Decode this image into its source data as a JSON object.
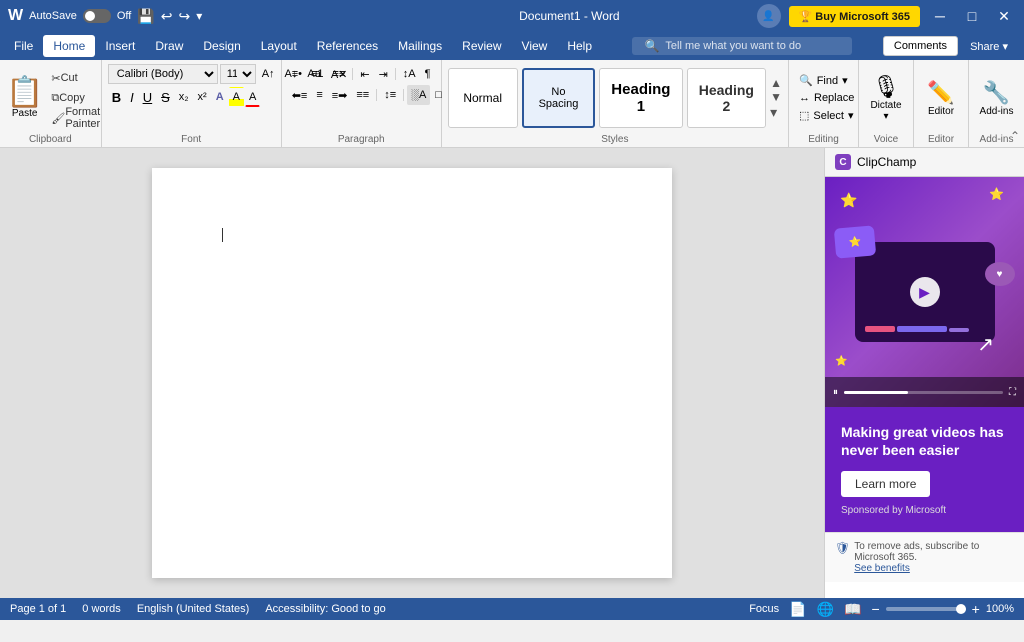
{
  "titleBar": {
    "logo": "W",
    "autosave": "AutoSave",
    "autosave_toggle": "Off",
    "save_icon": "💾",
    "undo_icon": "↩",
    "redo_icon": "↪",
    "customize_icon": "▾",
    "document_title": "Document1 - Word",
    "profile_icon": "👤",
    "buy_label": "🏆 Buy Microsoft 365",
    "minimize": "─",
    "restore": "□",
    "close": "✕"
  },
  "menuBar": {
    "items": [
      "File",
      "Home",
      "Insert",
      "Draw",
      "Design",
      "Layout",
      "References",
      "Mailings",
      "Review",
      "View",
      "Help"
    ]
  },
  "ribbon": {
    "clipboard": {
      "paste_label": "Paste",
      "cut_label": "Cut",
      "copy_label": "Copy",
      "format_painter_label": "Format Painter",
      "group_label": "Clipboard"
    },
    "font": {
      "font_name": "Calibri (Body)",
      "font_size": "11",
      "grow_label": "A",
      "shrink_label": "A",
      "change_case_label": "Aa",
      "clear_format_label": "A",
      "bold": "B",
      "italic": "I",
      "underline": "U",
      "strikethrough": "S",
      "subscript": "x₂",
      "superscript": "x²",
      "text_effects": "A",
      "highlight": "A",
      "font_color": "A",
      "group_label": "Font"
    },
    "paragraph": {
      "bullets": "≡",
      "numbering": "≡",
      "multilevel": "≡",
      "decrease_indent": "⇤",
      "increase_indent": "⇥",
      "sort": "↕",
      "show_para": "¶",
      "align_left": "≡",
      "align_center": "≡",
      "align_right": "≡",
      "justify": "≡",
      "line_spacing": "≡",
      "shading": "░",
      "border": "□",
      "group_label": "Paragraph"
    },
    "styles": {
      "normal": "Normal",
      "no_spacing": "No Spacing",
      "heading1": "Heading 1",
      "heading2": "Heading 2",
      "scroll_down": "▾",
      "group_label": "Styles"
    },
    "editing": {
      "find": "Find",
      "replace": "Replace",
      "select": "Select",
      "group_label": "Editing"
    },
    "voice": {
      "dictate_label": "Dictate",
      "group_label": "Voice"
    },
    "editor": {
      "editor_label": "Editor",
      "group_label": "Editor"
    },
    "addins": {
      "label": "Add-ins",
      "group_label": "Add-ins"
    }
  },
  "topbar": {
    "search_placeholder": "Tell me what you want to do",
    "comments_label": "Comments",
    "share_label": "Share ▾"
  },
  "document": {
    "cursor_visible": true
  },
  "adPanel": {
    "title": "ClipChamp",
    "ad_title": "Making great videos has never been easier",
    "learn_more": "Learn more",
    "sponsored": "Sponsored by Microsoft",
    "footer_text": "To remove ads, subscribe to Microsoft 365.",
    "see_benefits": "See benefits"
  },
  "statusBar": {
    "page": "Page 1 of 1",
    "words": "0 words",
    "language": "English (United States)",
    "accessibility": "Accessibility: Good to go",
    "focus": "Focus",
    "view_print": "📄",
    "view_web": "🌐",
    "zoom": "100%"
  }
}
